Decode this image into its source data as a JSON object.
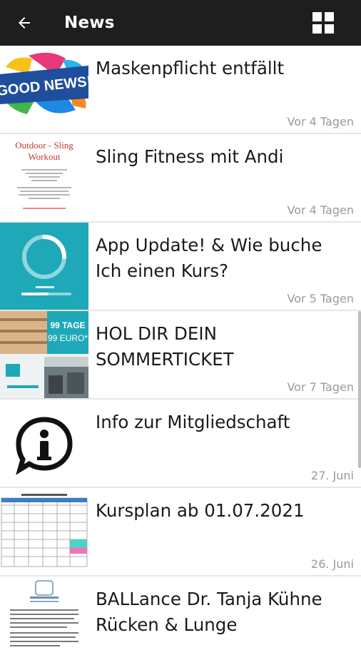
{
  "appbar": {
    "title": "News"
  },
  "items": [
    {
      "title": "Maskenpflicht entfällt",
      "date": "Vor 4 Tagen",
      "thumb_icon": "good-news-thumbnail",
      "thumb_text": "GOOD NEWS!"
    },
    {
      "title": "Sling Fitness mit Andi",
      "date": "Vor 4 Tagen",
      "thumb_icon": "outdoor-workout-thumbnail",
      "thumb_heading": "Outdoor - Sling Workout"
    },
    {
      "title": "App Update! & Wie buche Ich einen Kurs?",
      "date": "Vor 5 Tagen",
      "thumb_icon": "app-update-thumbnail"
    },
    {
      "title": "HOL DIR DEIN SOMMERTICKET",
      "date": "Vor 7 Tagen",
      "thumb_icon": "sommerticket-thumbnail",
      "thumb_tag_line1": "99 TAGE",
      "thumb_tag_line2": "99 EURO*"
    },
    {
      "title": "Info zur Mitgliedschaft",
      "date": "27. Juni",
      "thumb_icon": "info-bubble-icon"
    },
    {
      "title": "Kursplan ab 01.07.2021",
      "date": "26. Juni",
      "thumb_icon": "kursplan-thumbnail"
    },
    {
      "title": "BALLance Dr. Tanja Kühne Rücken & Lunge",
      "date": "",
      "thumb_icon": "ballance-thumbnail"
    }
  ],
  "colors": {
    "appbar": "#1e1e1e",
    "teal": "#1fa8b8",
    "date": "#9a9a9a",
    "divider": "#e6e6e6"
  }
}
